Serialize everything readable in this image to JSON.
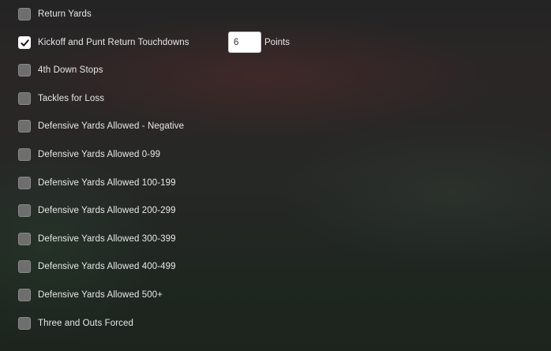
{
  "stats": [
    {
      "label": "Return Yards",
      "checked": false
    },
    {
      "label": "Kickoff and Punt Return Touchdowns",
      "checked": true
    },
    {
      "label": "4th Down Stops",
      "checked": false
    },
    {
      "label": "Tackles for Loss",
      "checked": false
    },
    {
      "label": "Defensive Yards Allowed - Negative",
      "checked": false
    },
    {
      "label": "Defensive Yards Allowed 0-99",
      "checked": false
    },
    {
      "label": "Defensive Yards Allowed 100-199",
      "checked": false
    },
    {
      "label": "Defensive Yards Allowed 200-299",
      "checked": false
    },
    {
      "label": "Defensive Yards Allowed 300-399",
      "checked": false
    },
    {
      "label": "Defensive Yards Allowed 400-499",
      "checked": false
    },
    {
      "label": "Defensive Yards Allowed 500+",
      "checked": false
    },
    {
      "label": "Three and Outs Forced",
      "checked": false
    }
  ],
  "points_field": {
    "value": "6",
    "unit_label": "Points"
  },
  "icons": {
    "checked": "checkmark-icon"
  },
  "colors": {
    "checkbox_unchecked": "#6e6e6e",
    "checkbox_checked": "#ffffff",
    "text": "#e8e8e8"
  }
}
